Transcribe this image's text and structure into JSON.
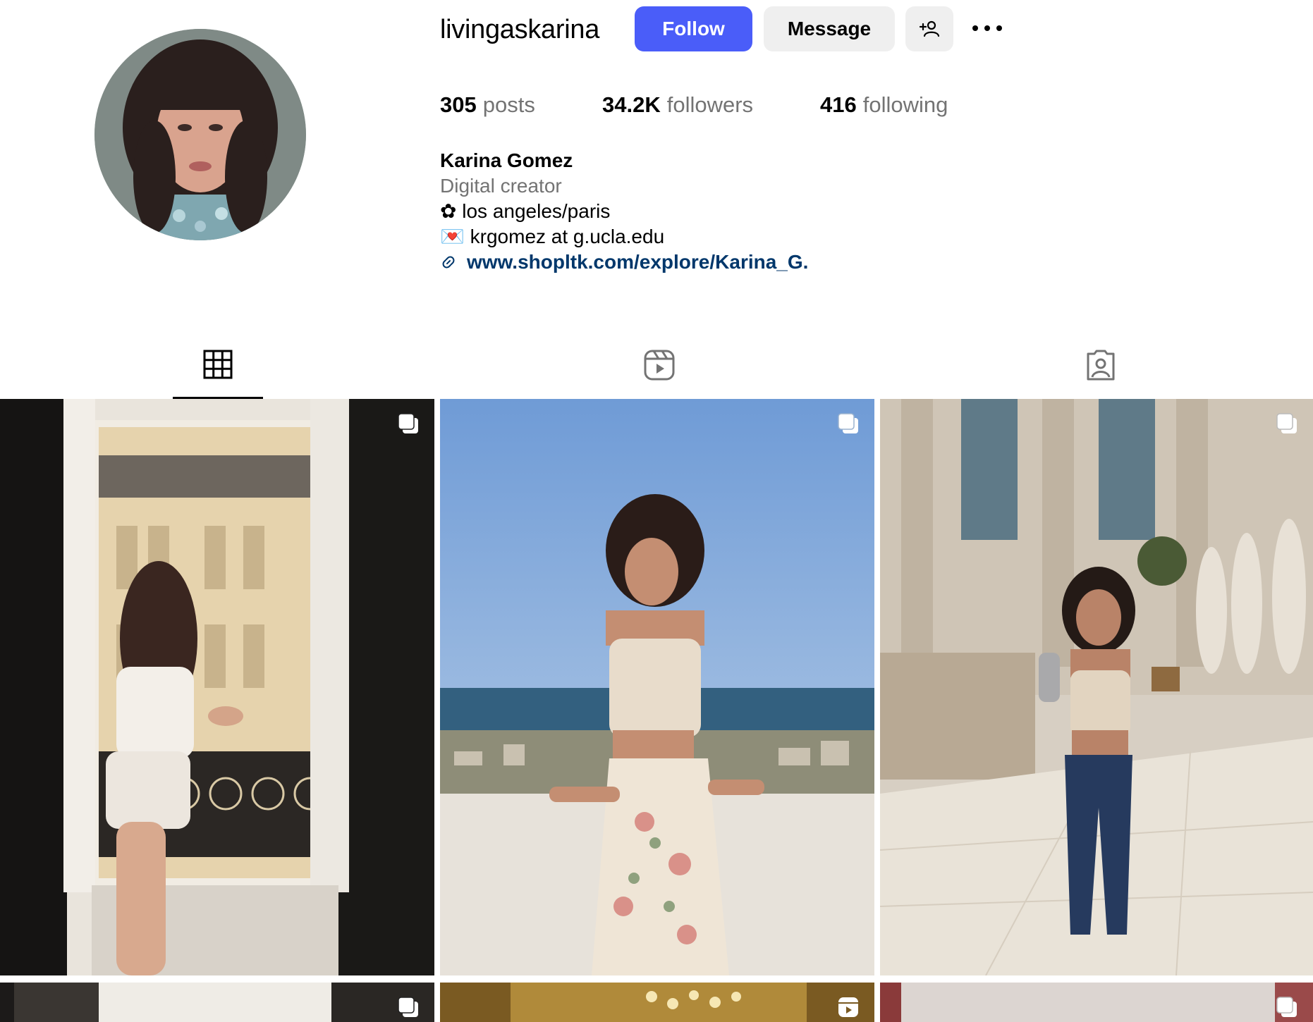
{
  "profile": {
    "username": "livingaskarina",
    "follow_label": "Follow",
    "message_label": "Message",
    "suggest_icon": "person-add-icon",
    "more_icon": "more-horizontal-icon",
    "avatar_alt": "avatar",
    "stats": {
      "posts_count": "305",
      "posts_label": "posts",
      "followers_count": "34.2K",
      "followers_label": "followers",
      "following_count": "416",
      "following_label": "following"
    },
    "bio": {
      "full_name": "Karina Gomez",
      "category": "Digital creator",
      "location_glyph": "✿",
      "location": "los angeles/paris",
      "email_glyph": "💌",
      "email": "krgomez at g.ucla.edu",
      "link_icon": "link-icon",
      "link": "www.shopltk.com/explore/Karina_G."
    }
  },
  "tabs": [
    {
      "icon": "grid-icon",
      "active": true
    },
    {
      "icon": "reels-icon",
      "active": false
    },
    {
      "icon": "tagged-icon",
      "active": false
    }
  ],
  "posts": [
    {
      "badge": "carousel-icon"
    },
    {
      "badge": "carousel-icon"
    },
    {
      "badge": "carousel-icon"
    },
    {
      "badge": "carousel-icon"
    },
    {
      "badge": "reel-icon"
    },
    {
      "badge": "carousel-icon"
    }
  ],
  "colors": {
    "accent": "#4a5df9",
    "secondary_button": "#efefef",
    "muted_text": "#737373",
    "link_text": "#00376b"
  }
}
